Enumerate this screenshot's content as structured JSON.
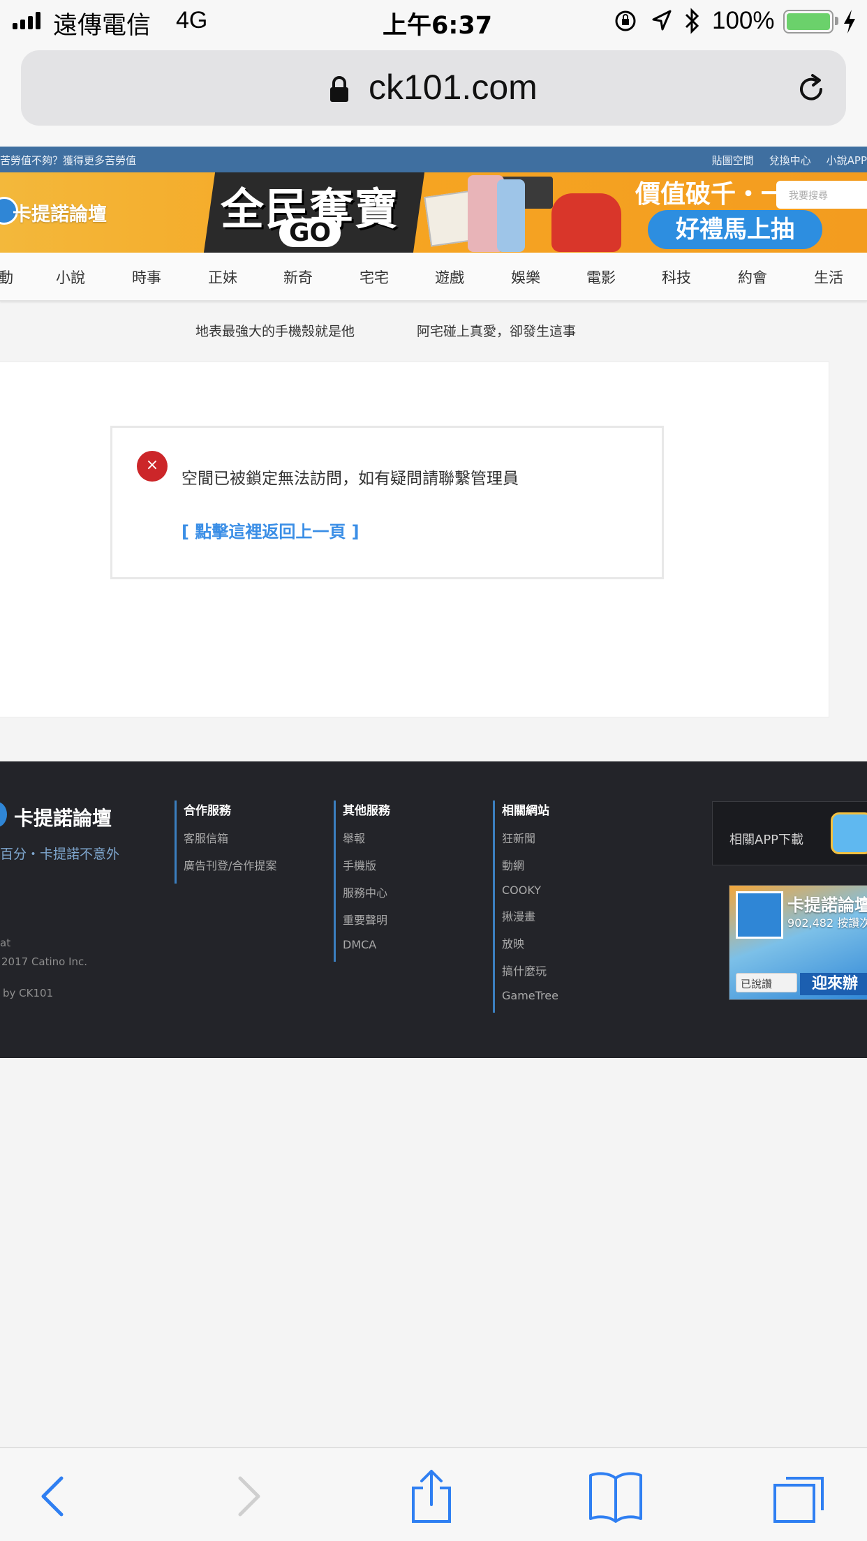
{
  "status_bar": {
    "carrier": "遠傳電信",
    "network": "4G",
    "time": "上午6:37",
    "battery_percent": "100%",
    "battery_level": 1.0,
    "icons": [
      "signal-icon",
      "orientation-lock-icon",
      "location-icon",
      "bluetooth-icon",
      "battery-icon",
      "charging-icon"
    ]
  },
  "browser": {
    "url": "ck101.com",
    "icons": [
      "lock-icon",
      "reload-icon"
    ]
  },
  "site": {
    "top_strip": {
      "promo": "苦勞值不夠？獲得更多苦勞值",
      "links": [
        "貼圖空間",
        "兌換中心",
        "小說APP"
      ]
    },
    "banner": {
      "logo": "卡提諾論壇",
      "promo_title": "全民奪寶",
      "promo_go": "GO",
      "promo_right": "價值破千・一件不留",
      "promo_pill": "好禮馬上抽",
      "search_placeholder": "我要搜尋"
    },
    "nav": [
      "動",
      "小說",
      "時事",
      "正妹",
      "新奇",
      "宅宅",
      "遊戲",
      "娛樂",
      "電影",
      "科技",
      "約會",
      "生活"
    ],
    "headlines": [
      "地表最強大的手機殼就是他",
      "阿宅碰上真愛，卻發生這事"
    ],
    "message": {
      "error_text": "空間已被鎖定無法訪問，如有疑問請聯繫管理員",
      "back_link": "[ 點擊這裡返回上一頁 ]",
      "error_icon": "×"
    },
    "footer": {
      "logo": "卡提諾論壇",
      "slogan": "百分・卡提諾不意外",
      "meta": [
        "at",
        "2017 Catino Inc.",
        "by CK101"
      ],
      "columns": [
        {
          "heading": "合作服務",
          "items": [
            "客服信箱",
            "廣告刊登/合作提案"
          ]
        },
        {
          "heading": "其他服務",
          "items": [
            "舉報",
            "手機版",
            "服務中心",
            "重要聲明",
            "DMCA"
          ]
        },
        {
          "heading": "相關網站",
          "items": [
            "狂新聞",
            "動網",
            "COOKY",
            "揪漫畫",
            "放映",
            "搞什麼玩",
            "GameTree"
          ]
        }
      ],
      "app_download": "相關APP下載",
      "fb_widget": {
        "name": "卡提諾論壇",
        "count": "902,482 按讚次",
        "like_label": "已說讚",
        "banner": "迎來辦"
      }
    }
  },
  "toolbar": {
    "icons": [
      "back-icon",
      "forward-icon",
      "share-icon",
      "bookmarks-icon",
      "tabs-icon"
    ]
  },
  "colors": {
    "accent": "#3a8ee6",
    "top_strip": "#3f6fa0",
    "footer_bg": "#232429",
    "error_red": "#cc2629",
    "banner_orange": "#f6a623"
  }
}
